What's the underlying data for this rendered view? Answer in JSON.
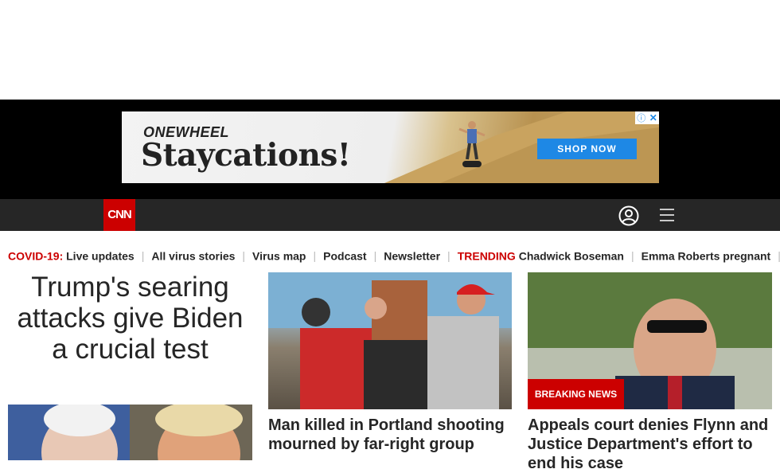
{
  "ad": {
    "brand": "ONEWHEEL",
    "headline": "Staycations!",
    "cta": "SHOP NOW",
    "info_icon": "info-icon",
    "close_icon": "close-icon"
  },
  "nav": {
    "logo_text": "CNN",
    "user_icon": "user-icon",
    "menu_icon": "menu-icon"
  },
  "trending_bar": {
    "covid_label": "COVID-19:",
    "covid_items": [
      "Live updates",
      "All virus stories",
      "Virus map",
      "Podcast",
      "Newsletter"
    ],
    "trending_label": "TRENDING",
    "trending_items": [
      "Chadwick Boseman",
      "Emma Roberts pregnant"
    ]
  },
  "stories": {
    "lead_headline": "Trump's searing attacks give Biden a crucial test",
    "story2_title": "Man killed in Portland shooting mourned by far-right group",
    "story3_badge": "BREAKING NEWS",
    "story3_title": "Appeals court denies Flynn and Justice Department's effort to end his case"
  },
  "colors": {
    "cnn_red": "#cc0000",
    "nav_bg": "#262626",
    "ad_cta": "#1e88e5"
  }
}
